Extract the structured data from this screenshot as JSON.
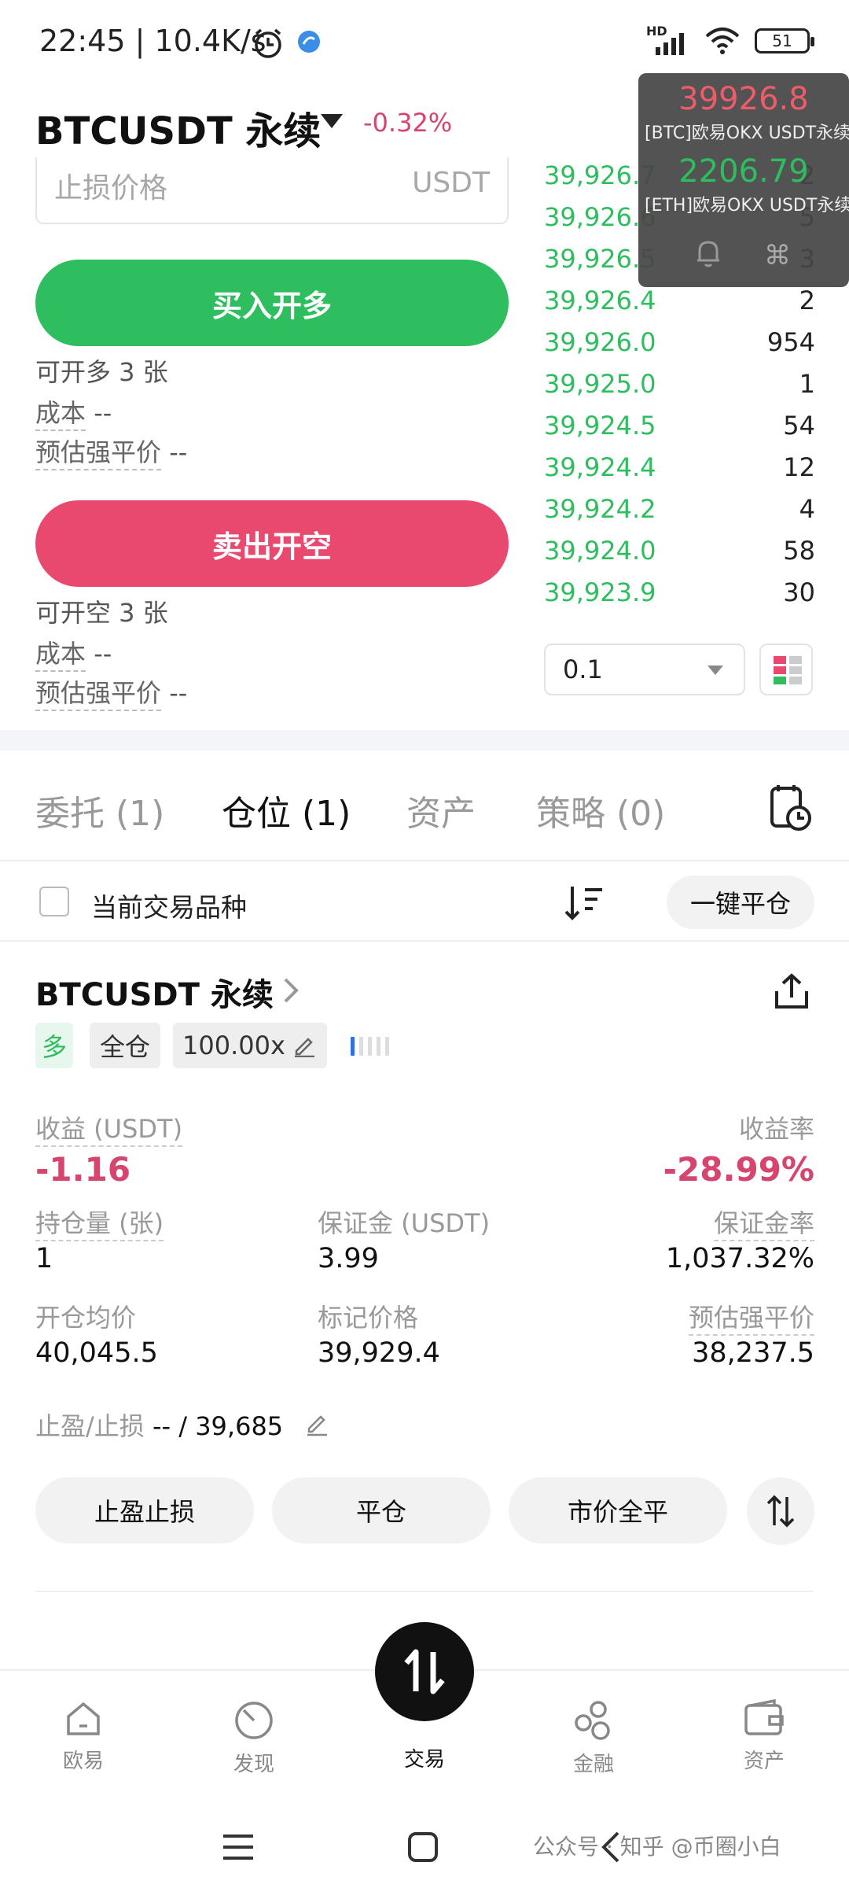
{
  "status_bar": {
    "time": "22:45 | 10.4K/s",
    "battery": "51",
    "network": "HD"
  },
  "header": {
    "pair": "BTCUSDT 永续",
    "change": "-0.32%"
  },
  "order_form": {
    "stop_price_placeholder": "止损价格",
    "stop_price_unit": "USDT",
    "buy_label": "买入开多",
    "buy_available": "可开多 3 张",
    "sell_label": "卖出开空",
    "sell_available": "可开空 3 张",
    "cost_label": "成本",
    "cost_value": "--",
    "liq_label": "预估强平价",
    "liq_value": "--"
  },
  "order_book": {
    "rows": [
      {
        "price": "39,926.7",
        "qty": "2"
      },
      {
        "price": "39,926.6",
        "qty": "5"
      },
      {
        "price": "39,926.5",
        "qty": "3"
      },
      {
        "price": "39,926.4",
        "qty": "2"
      },
      {
        "price": "39,926.0",
        "qty": "954"
      },
      {
        "price": "39,925.0",
        "qty": "1"
      },
      {
        "price": "39,924.5",
        "qty": "54"
      },
      {
        "price": "39,924.4",
        "qty": "12"
      },
      {
        "price": "39,924.2",
        "qty": "4"
      },
      {
        "price": "39,924.0",
        "qty": "58"
      },
      {
        "price": "39,923.9",
        "qty": "30"
      }
    ],
    "amount_value": "0.1"
  },
  "ticker_overlay": {
    "btc_price": "39926.8",
    "btc_label": "[BTC]欧易OKX USDT永续",
    "eth_price": "2206.79",
    "eth_label": "[ETH]欧易OKX USDT永续",
    "cmd_glyph": "⌘"
  },
  "tabs": [
    {
      "label": "委托 (1)"
    },
    {
      "label": "仓位 (1)"
    },
    {
      "label": "资产"
    },
    {
      "label": "策略 (0)"
    }
  ],
  "filter": {
    "current_pair_label": "当前交易品种",
    "close_all_label": "一键平仓"
  },
  "position": {
    "title": "BTCUSDT 永续",
    "side_tag": "多",
    "margin_mode_tag": "全仓",
    "leverage_tag": "100.00x",
    "pnl_label": "收益 (USDT)",
    "pnl_value": "-1.16",
    "roi_label": "收益率",
    "roi_value": "-28.99%",
    "size_label": "持仓量 (张)",
    "size_value": "1",
    "margin_label": "保证金 (USDT)",
    "margin_value": "3.99",
    "margin_ratio_label": "保证金率",
    "margin_ratio_value": "1,037.32%",
    "entry_label": "开仓均价",
    "entry_value": "40,045.5",
    "mark_label": "标记价格",
    "mark_value": "39,929.4",
    "liq_label": "预估强平价",
    "liq_value": "38,237.5",
    "tpsl_label": "止盈/止损",
    "tpsl_value": "-- / 39,685",
    "btn_tpsl": "止盈止损",
    "btn_close": "平仓",
    "btn_market_close": "市价全平"
  },
  "bottom_nav": [
    {
      "label": "欧易"
    },
    {
      "label": "发现"
    },
    {
      "label": "交易"
    },
    {
      "label": "金融"
    },
    {
      "label": "资产"
    }
  ],
  "watermark": "公众号 · 知乎 @币圈小白",
  "colors": {
    "buy_green": "#2ebd5f",
    "sell_red": "#e9496f",
    "negative": "#d6456d",
    "accent_blue": "#2f6fe0"
  }
}
